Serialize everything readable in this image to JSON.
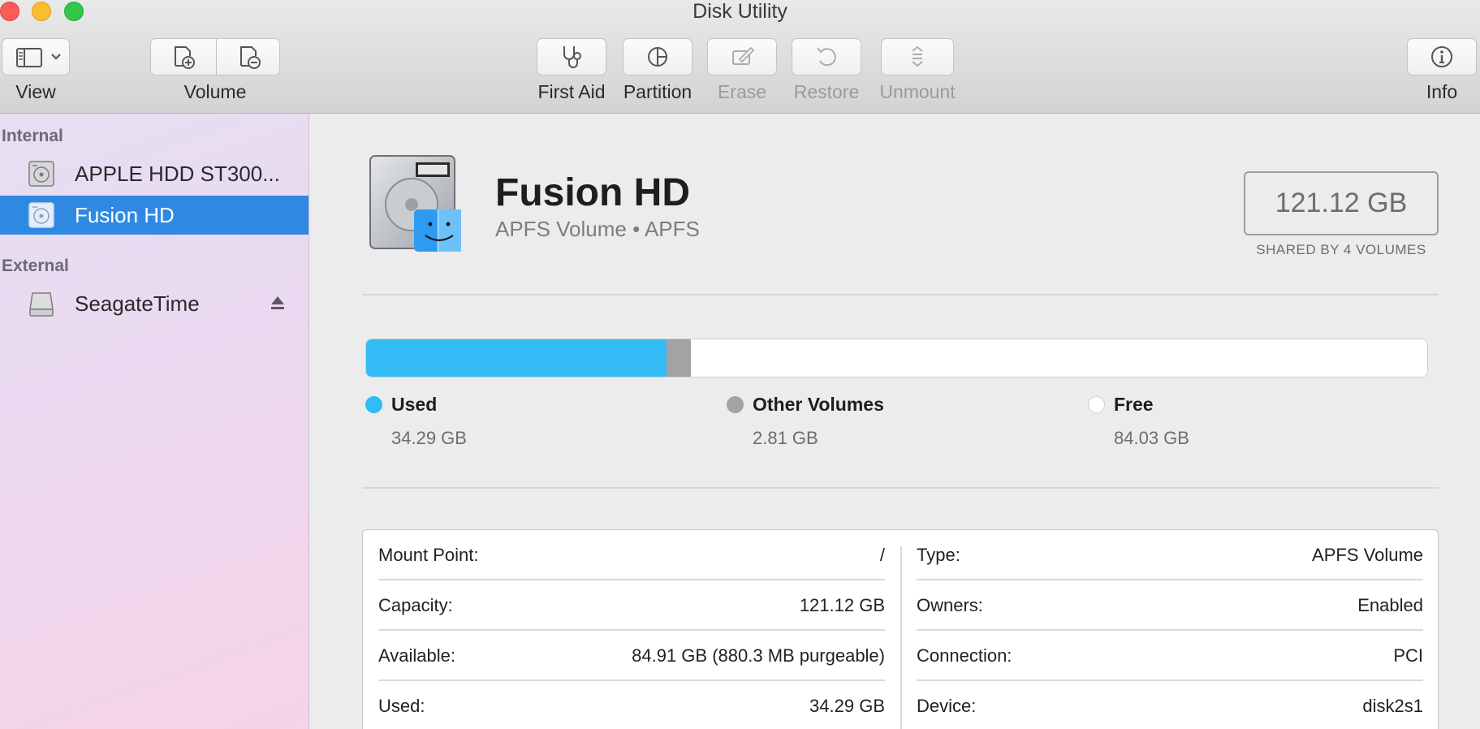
{
  "window": {
    "title": "Disk Utility"
  },
  "toolbar": {
    "view_label": "View",
    "volume_label": "Volume",
    "first_aid_label": "First Aid",
    "partition_label": "Partition",
    "erase_label": "Erase",
    "restore_label": "Restore",
    "unmount_label": "Unmount",
    "info_label": "Info",
    "disabled": [
      "Erase",
      "Restore",
      "Unmount"
    ]
  },
  "sidebar": {
    "sections": [
      {
        "header": "Internal",
        "items": [
          {
            "label": "APPLE HDD ST300...",
            "icon": "internal-disk-icon",
            "selected": false
          },
          {
            "label": "Fusion HD",
            "icon": "volume-disk-icon",
            "selected": true
          }
        ]
      },
      {
        "header": "External",
        "items": [
          {
            "label": "SeagateTime",
            "icon": "external-disk-icon",
            "selected": false,
            "ejectable": true
          }
        ]
      }
    ]
  },
  "volume": {
    "name": "Fusion HD",
    "subtitle": "APFS Volume • APFS",
    "capacity": "121.12 GB",
    "capacity_caption": "SHARED BY 4 VOLUMES"
  },
  "usage": {
    "used": {
      "label": "Used",
      "value": "34.29 GB",
      "fraction": 0.2831,
      "color": "#32bbf5"
    },
    "other": {
      "label": "Other Volumes",
      "value": "2.81 GB",
      "fraction": 0.0232,
      "color": "#a3a3a3"
    },
    "free": {
      "label": "Free",
      "value": "84.03 GB",
      "color": "#ffffff"
    }
  },
  "info": {
    "left": [
      {
        "key": "Mount Point:",
        "value": "/"
      },
      {
        "key": "Capacity:",
        "value": "121.12 GB"
      },
      {
        "key": "Available:",
        "value": "84.91 GB (880.3 MB purgeable)"
      },
      {
        "key": "Used:",
        "value": "34.29 GB"
      }
    ],
    "right": [
      {
        "key": "Type:",
        "value": "APFS Volume"
      },
      {
        "key": "Owners:",
        "value": "Enabled"
      },
      {
        "key": "Connection:",
        "value": "PCI"
      },
      {
        "key": "Device:",
        "value": "disk2s1"
      }
    ]
  },
  "colors": {
    "selection": "#2f89e3",
    "accent_blue": "#32bbf5"
  }
}
